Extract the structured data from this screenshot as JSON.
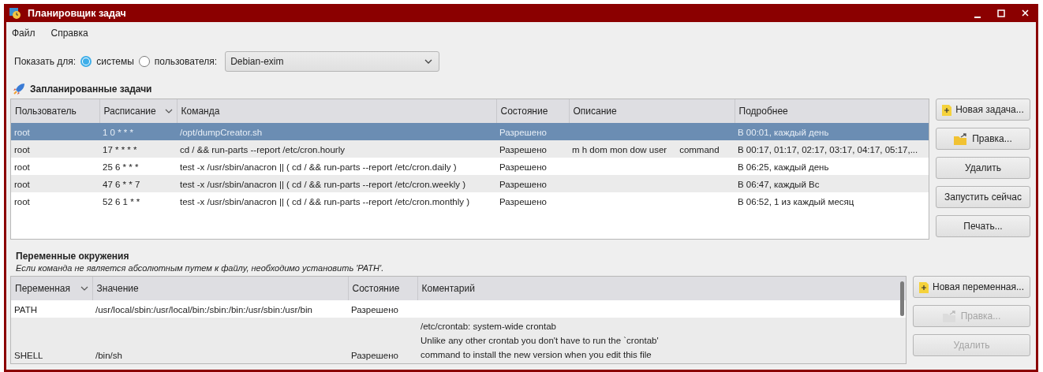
{
  "window": {
    "title": "Планировщик задач"
  },
  "menu": [
    "Файл",
    "Справка"
  ],
  "show_for": {
    "label": "Показать для:",
    "options": [
      {
        "label": "системы",
        "selected": true
      },
      {
        "label": "пользователя:",
        "selected": false
      }
    ],
    "user": "Debian-exim"
  },
  "tasks": {
    "title": "Запланированные задачи",
    "columns": [
      {
        "label": "Пользователь",
        "sorted": false
      },
      {
        "label": "Расписание",
        "sorted": true
      },
      {
        "label": "Команда",
        "sorted": false
      },
      {
        "label": "Состояние",
        "sorted": false
      },
      {
        "label": "Описание",
        "sorted": false
      },
      {
        "label": "Подробнее",
        "sorted": false
      }
    ],
    "rows": [
      {
        "selected": true,
        "cells": [
          "root",
          "1 0 * * *",
          "/opt/dumpCreator.sh",
          "Разрешено",
          "",
          "В 00:01, каждый день"
        ]
      },
      {
        "selected": false,
        "cells": [
          "root",
          "17 * * * *",
          "cd / && run-parts --report /etc/cron.hourly",
          "Разрешено",
          "m h dom mon dow user     command",
          "В 00:17, 01:17, 02:17, 03:17, 04:17, 05:17,..."
        ]
      },
      {
        "selected": false,
        "cells": [
          "root",
          "25 6 * * *",
          "test -x /usr/sbin/anacron || ( cd / && run-parts --report /etc/cron.daily )",
          "Разрешено",
          "",
          "В 06:25, каждый день"
        ]
      },
      {
        "selected": false,
        "cells": [
          "root",
          "47 6 * * 7",
          "test -x /usr/sbin/anacron || ( cd / && run-parts --report /etc/cron.weekly )",
          "Разрешено",
          "",
          "В 06:47, каждый Вс"
        ]
      },
      {
        "selected": false,
        "cells": [
          "root",
          "52 6 1 * *",
          "test -x /usr/sbin/anacron || ( cd / && run-parts --report /etc/cron.monthly )",
          "Разрешено",
          "",
          "В 06:52, 1 из каждый месяц"
        ]
      }
    ],
    "buttons": [
      {
        "label": "Новая задача...",
        "kind": "new",
        "disabled": false
      },
      {
        "label": "Правка...",
        "kind": "edit",
        "disabled": false
      },
      {
        "label": "Удалить",
        "kind": "plain",
        "disabled": false
      },
      {
        "label": "Запустить сейчас",
        "kind": "plain",
        "disabled": false
      },
      {
        "label": "Печать...",
        "kind": "plain",
        "disabled": false
      }
    ]
  },
  "environment": {
    "title": "Переменные окружения",
    "hint": "Если команда не является абсолютным путем к файлу, необходимо установить 'PATH'.",
    "columns": [
      {
        "label": "Переменная",
        "sorted": true
      },
      {
        "label": "Значение",
        "sorted": false
      },
      {
        "label": "Состояние",
        "sorted": false
      },
      {
        "label": "Коментарий",
        "sorted": false
      }
    ],
    "rows": [
      {
        "selected": false,
        "cells": [
          "PATH",
          "/usr/local/sbin:/usr/local/bin:/sbin:/bin:/usr/sbin:/usr/bin",
          "Разрешено",
          ""
        ]
      },
      {
        "selected": false,
        "cells": [
          "SHELL",
          "/bin/sh",
          "Разрешено",
          "/etc/crontab: system-wide crontab\nUnlike any other crontab you don't have to run the `crontab'\ncommand to install the new version when you edit this file"
        ]
      }
    ],
    "buttons": [
      {
        "label": "Новая переменная...",
        "kind": "new",
        "disabled": false
      },
      {
        "label": "Правка...",
        "kind": "edit",
        "disabled": true
      },
      {
        "label": "Удалить",
        "kind": "plain",
        "disabled": true
      }
    ]
  }
}
